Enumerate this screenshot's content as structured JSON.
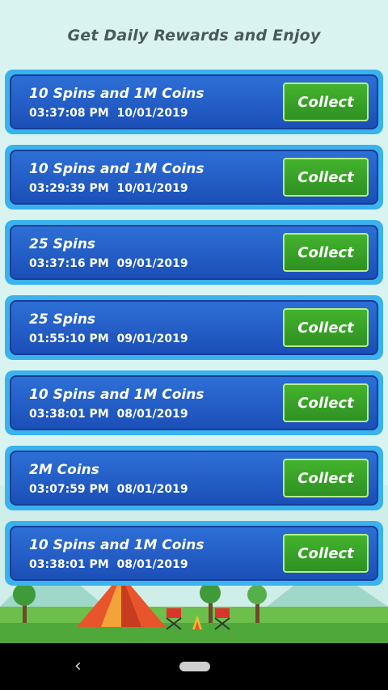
{
  "header": {
    "title": "Get Daily Rewards and Enjoy"
  },
  "rewards": [
    {
      "title": "10 Spins and 1M Coins",
      "time": "03:37:08 PM",
      "date": "10/01/2019",
      "button": "Collect"
    },
    {
      "title": "10 Spins and 1M Coins",
      "time": "03:29:39 PM",
      "date": "10/01/2019",
      "button": "Collect"
    },
    {
      "title": "25 Spins",
      "time": "03:37:16 PM",
      "date": "09/01/2019",
      "button": "Collect"
    },
    {
      "title": "25 Spins",
      "time": "01:55:10 PM",
      "date": "09/01/2019",
      "button": "Collect"
    },
    {
      "title": "10 Spins and 1M Coins",
      "time": "03:38:01 PM",
      "date": "08/01/2019",
      "button": "Collect"
    },
    {
      "title": "2M Coins",
      "time": "03:07:59 PM",
      "date": "08/01/2019",
      "button": "Collect"
    },
    {
      "title": "10 Spins and 1M Coins",
      "time": "03:38:01 PM",
      "date": "08/01/2019",
      "button": "Collect"
    }
  ],
  "navbar": {
    "back_glyph": "‹"
  },
  "colors": {
    "card_border": "#39b2ee",
    "card_fill": "#2d6fd6",
    "button_green": "#43b32d",
    "background": "#d9f3f1"
  }
}
